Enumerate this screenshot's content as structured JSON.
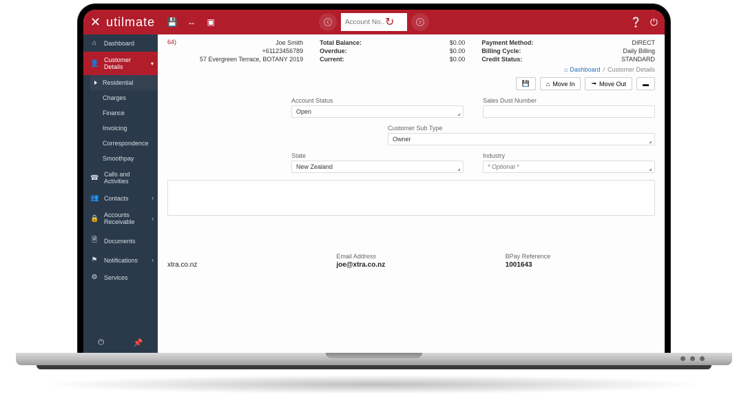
{
  "brand": "utilmate",
  "search": {
    "placeholder": "Account No..."
  },
  "sidebar": {
    "items": [
      {
        "label": "Dashboard"
      },
      {
        "label": "Customer Details"
      },
      {
        "label": "Residential"
      },
      {
        "label": "Charges"
      },
      {
        "label": "Finance"
      },
      {
        "label": "Invoicing"
      },
      {
        "label": "Correspondence"
      },
      {
        "label": "Smoothpay"
      },
      {
        "label": "Calls and Activities"
      },
      {
        "label": "Contacts"
      },
      {
        "label": "Accounts Receivable"
      },
      {
        "label": "Documents"
      },
      {
        "label": "Notifications"
      },
      {
        "label": "Services"
      }
    ]
  },
  "header": {
    "id_suffix": "64)",
    "name": "Joe Smith",
    "phone": "+61123456789",
    "address": "57 Evergreen Terrace, BOTANY 2019",
    "balances": {
      "total_label": "Total Balance:",
      "total": "$0.00",
      "overdue_label": "Overdue:",
      "overdue": "$0.00",
      "current_label": "Current:",
      "current": "$0.00"
    },
    "meta": {
      "pm_label": "Payment Method:",
      "pm": "DIRECT",
      "bc_label": "Billing Cycle:",
      "bc": "Daily Billing",
      "cs_label": "Credit Status:",
      "cs": "STANDARD"
    }
  },
  "crumb": {
    "home": "Dashboard",
    "here": "Customer Details"
  },
  "actions": {
    "movein": "Move In",
    "moveout": "Move Out"
  },
  "form": {
    "account_status": {
      "label": "Account Status",
      "value": "Open"
    },
    "sales_no": {
      "label": "Sales Dust Number",
      "value": ""
    },
    "cust_sub": {
      "label": "Customer Sub Type",
      "value": "Owner"
    },
    "state": {
      "label": "State",
      "value": "New Zealand"
    },
    "industry": {
      "label": "Industry",
      "placeholder": "* Optional *"
    }
  },
  "readout": {
    "domain": "xtra.co.nz",
    "email_label": "Email Address",
    "email": "joe@xtra.co.nz",
    "bpay_label": "BPay Reference",
    "bpay": "1001643"
  }
}
